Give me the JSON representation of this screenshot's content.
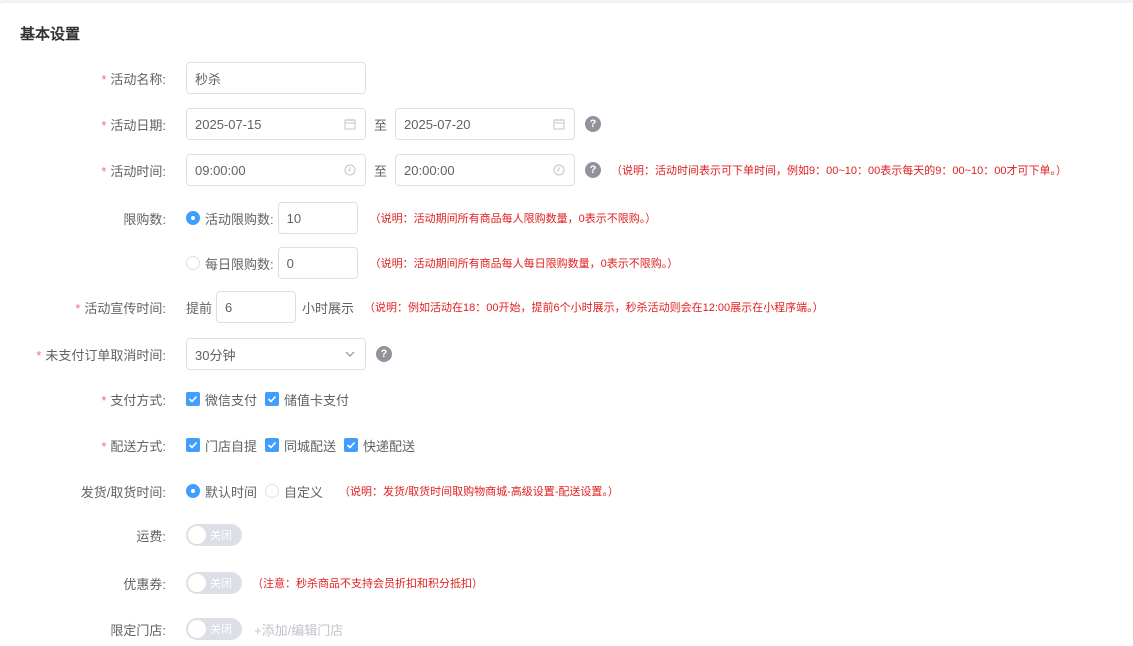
{
  "section_title": "基本设置",
  "activity_name": {
    "label": "活动名称:",
    "value": "秒杀"
  },
  "activity_date": {
    "label": "活动日期:",
    "start": "2025-07-15",
    "end": "2025-07-20",
    "sep": "至"
  },
  "activity_time": {
    "label": "活动时间:",
    "start": "09:00:00",
    "end": "20:00:00",
    "sep": "至",
    "note": "（说明：活动时间表示可下单时间，例如9：00~10：00表示每天的9：00~10：00才可下单。）"
  },
  "limit": {
    "label": "限购数:",
    "option_total": {
      "label": "活动限购数:",
      "value": "10",
      "note": "（说明：活动期间所有商品每人限购数量，0表示不限购。）"
    },
    "option_daily": {
      "label": "每日限购数:",
      "value": "0",
      "note": "（说明：活动期间所有商品每人每日限购数量，0表示不限购。）"
    }
  },
  "promo_time": {
    "label": "活动宣传时间:",
    "prefix": "提前",
    "value": "6",
    "suffix": "小时展示",
    "note": "（说明：例如活动在18：00开始，提前6个小时展示，秒杀活动则会在12:00展示在小程序端。）"
  },
  "unpaid_cancel": {
    "label": "未支付订单取消时间:",
    "value": "30分钟"
  },
  "payment": {
    "label": "支付方式:",
    "options": [
      "微信支付",
      "储值卡支付"
    ]
  },
  "delivery": {
    "label": "配送方式:",
    "options": [
      "门店自提",
      "同城配送",
      "快递配送"
    ]
  },
  "ship_time": {
    "label": "发货/取货时间:",
    "default": "默认时间",
    "custom": "自定义",
    "note": "（说明：发货/取货时间取购物商城-高级设置-配送设置。）"
  },
  "freight": {
    "label": "运费:",
    "switch": "关闭"
  },
  "coupon": {
    "label": "优惠券:",
    "switch": "关闭",
    "note": "（注意：秒杀商品不支持会员折扣和积分抵扣）"
  },
  "store": {
    "label": "限定门店:",
    "switch": "关闭",
    "link": "+添加/编辑门店"
  },
  "colors": {
    "primary": "#409eff",
    "required": "#f56c6c",
    "note": "#e02020"
  }
}
